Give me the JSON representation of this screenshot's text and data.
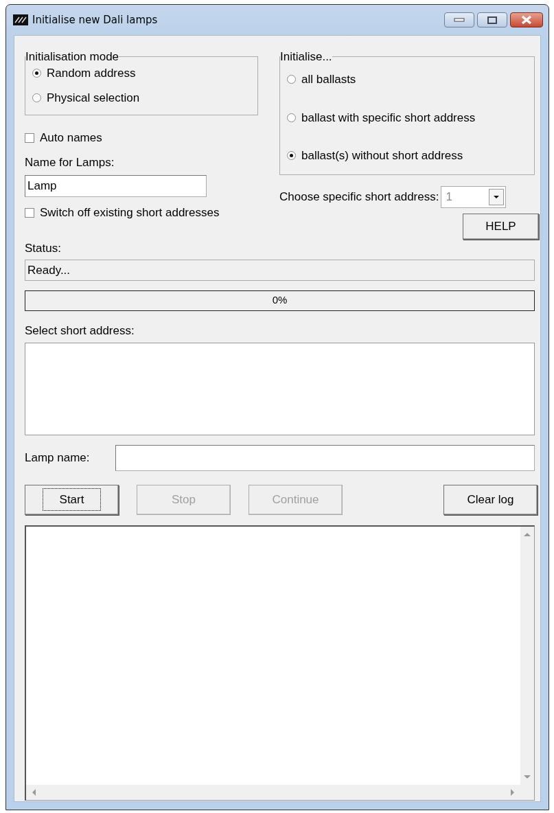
{
  "window": {
    "title": "Initialise new Dali lamps"
  },
  "mode_group": {
    "title": "Initialisation mode",
    "options": [
      {
        "label": "Random address",
        "selected": true
      },
      {
        "label": "Physical selection",
        "selected": false
      }
    ]
  },
  "auto_names": {
    "label": "Auto names",
    "checked": false
  },
  "name_for_lamps": {
    "label": "Name for Lamps:",
    "value": "Lamp"
  },
  "switch_off": {
    "label": "Switch off existing short addresses",
    "checked": false
  },
  "initialise_group": {
    "title": "Initialise...",
    "options": [
      {
        "label": "all ballasts",
        "selected": false
      },
      {
        "label": "ballast with specific short address",
        "selected": false
      },
      {
        "label": "ballast(s) without short address",
        "selected": true
      }
    ]
  },
  "short_address": {
    "label": "Choose specific short address:",
    "value": "1",
    "disabled": true
  },
  "help_button": {
    "label": "HELP"
  },
  "status": {
    "label": "Status:",
    "value": "Ready..."
  },
  "progress": {
    "level": 0,
    "reading": "0%"
  },
  "select_short_address": {
    "label": "Select short address:"
  },
  "lamp_name": {
    "label": "Lamp name:"
  },
  "buttons": [
    {
      "label": "Start",
      "disabled": false,
      "focused": true
    },
    {
      "label": "Stop",
      "disabled": true,
      "focused": false
    },
    {
      "label": "Continue",
      "disabled": true,
      "focused": false
    },
    {
      "label": "Clear log",
      "disabled": false,
      "focused": false
    }
  ]
}
